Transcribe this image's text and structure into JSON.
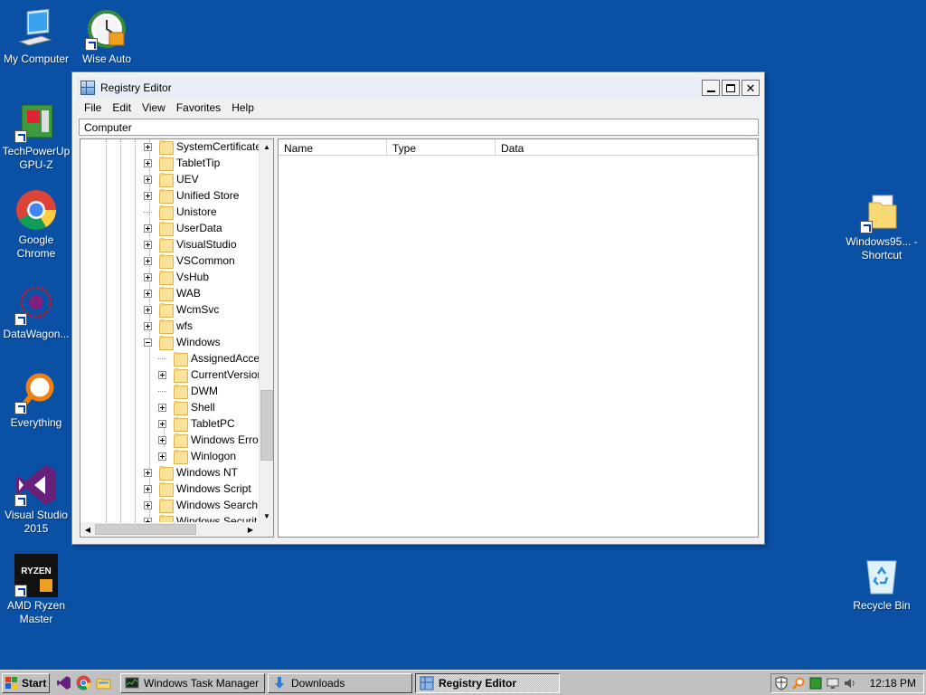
{
  "desktop": {
    "icons_left": [
      {
        "label": "My Computer"
      },
      {
        "label": "Wise Auto Shutdown"
      },
      {
        "label": "TechPowerUp GPU-Z"
      },
      {
        "label": "Google Chrome"
      },
      {
        "label": "DataWagon..."
      },
      {
        "label": "Everything"
      },
      {
        "label": "Visual Studio 2015"
      },
      {
        "label": "AMD Ryzen Master"
      }
    ],
    "icons_right": [
      {
        "label": "Windows95... - Shortcut"
      },
      {
        "label": "Recycle Bin"
      }
    ]
  },
  "window": {
    "title": "Registry Editor",
    "minimize_label": "",
    "maximize_label": "",
    "close_label": "✕",
    "menu": [
      "File",
      "Edit",
      "View",
      "Favorites",
      "Help"
    ],
    "address": "Computer",
    "tree": [
      {
        "label": "SystemCertificate",
        "level": 1,
        "exp": "plus"
      },
      {
        "label": "TabletTip",
        "level": 1,
        "exp": "plus"
      },
      {
        "label": "UEV",
        "level": 1,
        "exp": "plus"
      },
      {
        "label": "Unified Store",
        "level": 1,
        "exp": "plus"
      },
      {
        "label": "Unistore",
        "level": 1,
        "exp": "none"
      },
      {
        "label": "UserData",
        "level": 1,
        "exp": "plus"
      },
      {
        "label": "VisualStudio",
        "level": 1,
        "exp": "plus"
      },
      {
        "label": "VSCommon",
        "level": 1,
        "exp": "plus"
      },
      {
        "label": "VsHub",
        "level": 1,
        "exp": "plus"
      },
      {
        "label": "WAB",
        "level": 1,
        "exp": "plus"
      },
      {
        "label": "WcmSvc",
        "level": 1,
        "exp": "plus"
      },
      {
        "label": "wfs",
        "level": 1,
        "exp": "plus"
      },
      {
        "label": "Windows",
        "level": 1,
        "exp": "minus"
      },
      {
        "label": "AssignedAcce",
        "level": 2,
        "exp": "none"
      },
      {
        "label": "CurrentVersion",
        "level": 2,
        "exp": "plus"
      },
      {
        "label": "DWM",
        "level": 2,
        "exp": "none"
      },
      {
        "label": "Shell",
        "level": 2,
        "exp": "plus"
      },
      {
        "label": "TabletPC",
        "level": 2,
        "exp": "plus"
      },
      {
        "label": "Windows Error",
        "level": 2,
        "exp": "plus"
      },
      {
        "label": "Winlogon",
        "level": 2,
        "exp": "plus"
      },
      {
        "label": "Windows NT",
        "level": 1,
        "exp": "plus"
      },
      {
        "label": "Windows Script",
        "level": 1,
        "exp": "plus"
      },
      {
        "label": "Windows Search",
        "level": 1,
        "exp": "plus"
      },
      {
        "label": "Windows Securit",
        "level": 1,
        "exp": "plus"
      }
    ],
    "columns": [
      "Name",
      "Type",
      "Data"
    ]
  },
  "taskbar": {
    "start_label": "Start",
    "tasks": [
      {
        "label": "Windows Task Manager",
        "active": false
      },
      {
        "label": "Downloads",
        "active": false
      },
      {
        "label": "Registry Editor",
        "active": true
      }
    ],
    "clock": "12:18 PM"
  },
  "colors": {
    "desktop": "#0a50a5",
    "taskbar": "#c0c0c0"
  }
}
